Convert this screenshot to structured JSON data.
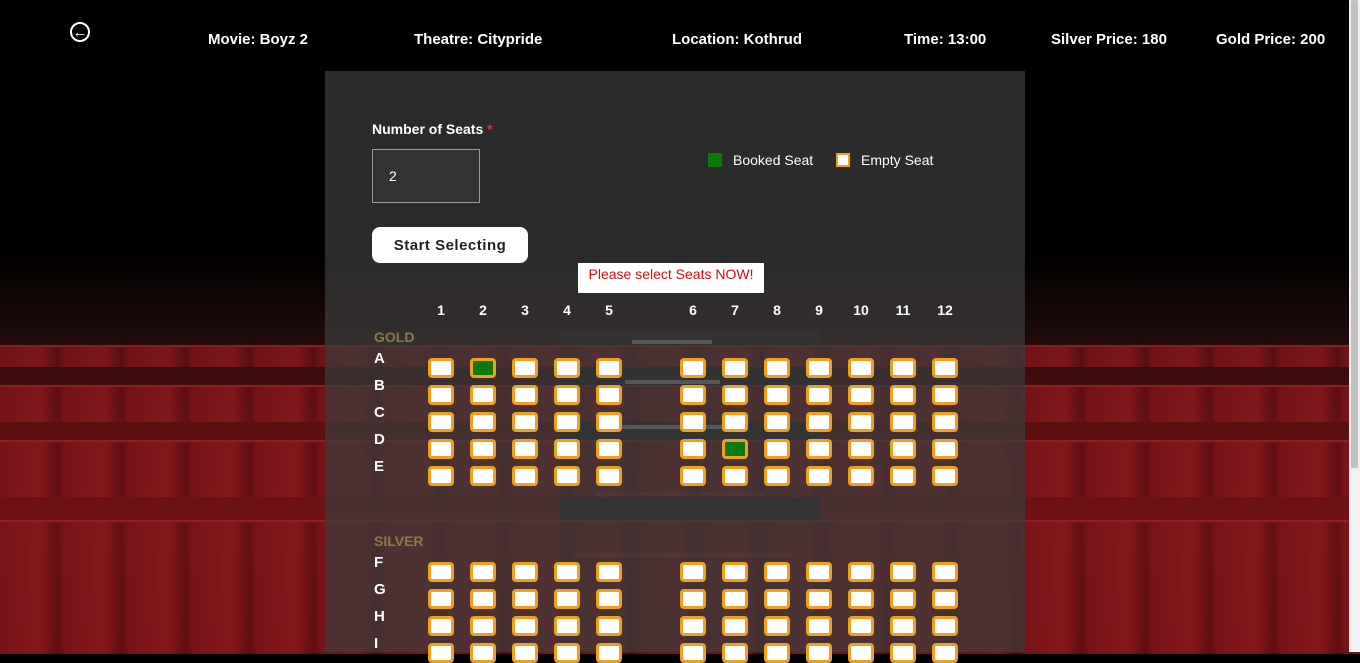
{
  "header": {
    "movie": "Movie: Boyz 2",
    "theatre": "Theatre: Citypride",
    "location": "Location: Kothrud",
    "time": "Time: 13:00",
    "silver_price": "Silver Price: 180",
    "gold_price": "Gold Price: 200"
  },
  "form": {
    "num_seats_label": "Number of Seats",
    "required_mark": "*",
    "num_seats_value": "2",
    "start_button": "Start Selecting",
    "message": "Please select Seats NOW!"
  },
  "legend": {
    "booked": "Booked Seat",
    "empty": "Empty Seat",
    "booked_color": "#0a7a0a",
    "empty_color": "#ffffff",
    "seat_border_color": "#f0a020"
  },
  "seatmap": {
    "columns": [
      "1",
      "2",
      "3",
      "4",
      "5",
      "6",
      "7",
      "8",
      "9",
      "10",
      "11",
      "12"
    ],
    "gold_label": "GOLD",
    "silver_label": "SILVER",
    "gold_rows": [
      "A",
      "B",
      "C",
      "D",
      "E"
    ],
    "silver_rows": [
      "F",
      "G",
      "H",
      "I"
    ],
    "booked_seats": [
      "A2",
      "D7"
    ]
  }
}
